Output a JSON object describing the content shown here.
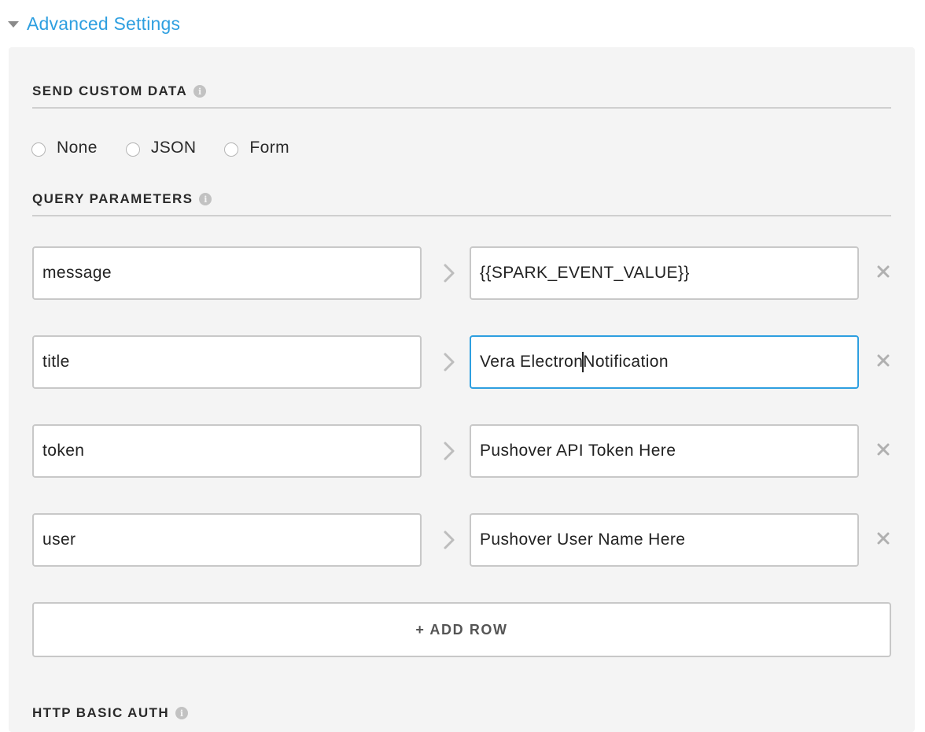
{
  "advanced": {
    "title": "Advanced Settings"
  },
  "custom_data": {
    "title": "SEND CUSTOM DATA",
    "options": [
      {
        "label": "None",
        "selected": false
      },
      {
        "label": "JSON",
        "selected": false
      },
      {
        "label": "Form",
        "selected": false
      }
    ]
  },
  "query_params": {
    "title": "QUERY PARAMETERS",
    "rows": [
      {
        "key": "message",
        "value": "{{SPARK_EVENT_VALUE}}"
      },
      {
        "key": "title",
        "value_before_cursor": "Vera Electron",
        "value_after_cursor": "Notification"
      },
      {
        "key": "token",
        "value": "Pushover API Token Here"
      },
      {
        "key": "user",
        "value": "Pushover User Name Here"
      }
    ],
    "add_row_label": "+ ADD ROW"
  },
  "basic_auth": {
    "title": "HTTP BASIC AUTH"
  },
  "icons": {
    "info": "info-icon",
    "arrow": "chevron-right-icon",
    "remove": "close-icon",
    "collapse": "caret-down-icon"
  },
  "colors": {
    "accent": "#2e9fe0",
    "panel_bg": "#f4f4f4",
    "border": "#c8c8c8"
  }
}
